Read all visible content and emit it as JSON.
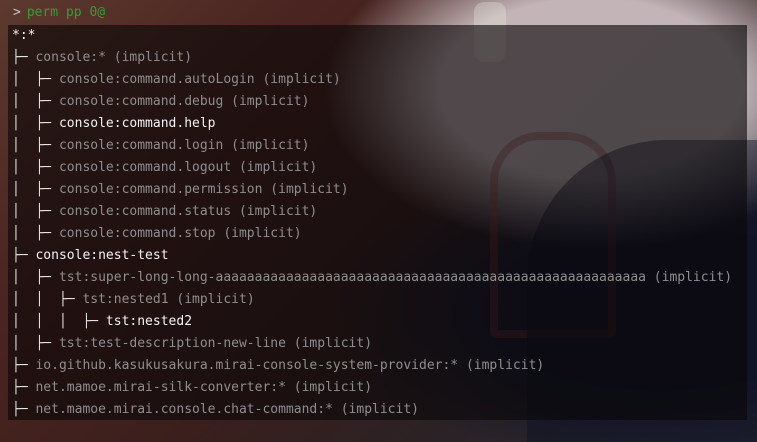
{
  "prompt": {
    "symbol": ">",
    "command": "perm pp 0@"
  },
  "tree_lines": [
    {
      "prefix": "",
      "text": "*:*",
      "explicit": true
    },
    {
      "prefix": "├─ ",
      "text": "console:* (implicit)",
      "explicit": false
    },
    {
      "prefix": "│  ├─ ",
      "text": "console:command.autoLogin (implicit)",
      "explicit": false
    },
    {
      "prefix": "│  ├─ ",
      "text": "console:command.debug (implicit)",
      "explicit": false
    },
    {
      "prefix": "│  ├─ ",
      "text": "console:command.help",
      "explicit": true
    },
    {
      "prefix": "│  ├─ ",
      "text": "console:command.login (implicit)",
      "explicit": false
    },
    {
      "prefix": "│  ├─ ",
      "text": "console:command.logout (implicit)",
      "explicit": false
    },
    {
      "prefix": "│  ├─ ",
      "text": "console:command.permission (implicit)",
      "explicit": false
    },
    {
      "prefix": "│  ├─ ",
      "text": "console:command.status (implicit)",
      "explicit": false
    },
    {
      "prefix": "│  ├─ ",
      "text": "console:command.stop (implicit)",
      "explicit": false
    },
    {
      "prefix": "├─ ",
      "text": "console:nest-test",
      "explicit": true
    },
    {
      "prefix": "│  ├─ ",
      "text": "tst:super-long-long-aaaaaaaaaaaaaaaaaaaaaaaaaaaaaaaaaaaaaaaaaaaaaaaaaaaaaaa (implicit)",
      "explicit": false
    },
    {
      "prefix": "│  │  ├─ ",
      "text": "tst:nested1 (implicit)",
      "explicit": false
    },
    {
      "prefix": "│  │  │  ├─ ",
      "text": "tst:nested2",
      "explicit": true
    },
    {
      "prefix": "│  ├─ ",
      "text": "tst:test-description-new-line (implicit)",
      "explicit": false
    },
    {
      "prefix": "├─ ",
      "text": "io.github.kasukusakura.mirai-console-system-provider:* (implicit)",
      "explicit": false
    },
    {
      "prefix": "├─ ",
      "text": "net.mamoe.mirai-silk-converter:* (implicit)",
      "explicit": false
    },
    {
      "prefix": "├─ ",
      "text": "net.mamoe.mirai.console.chat-command:* (implicit)",
      "explicit": false
    }
  ]
}
